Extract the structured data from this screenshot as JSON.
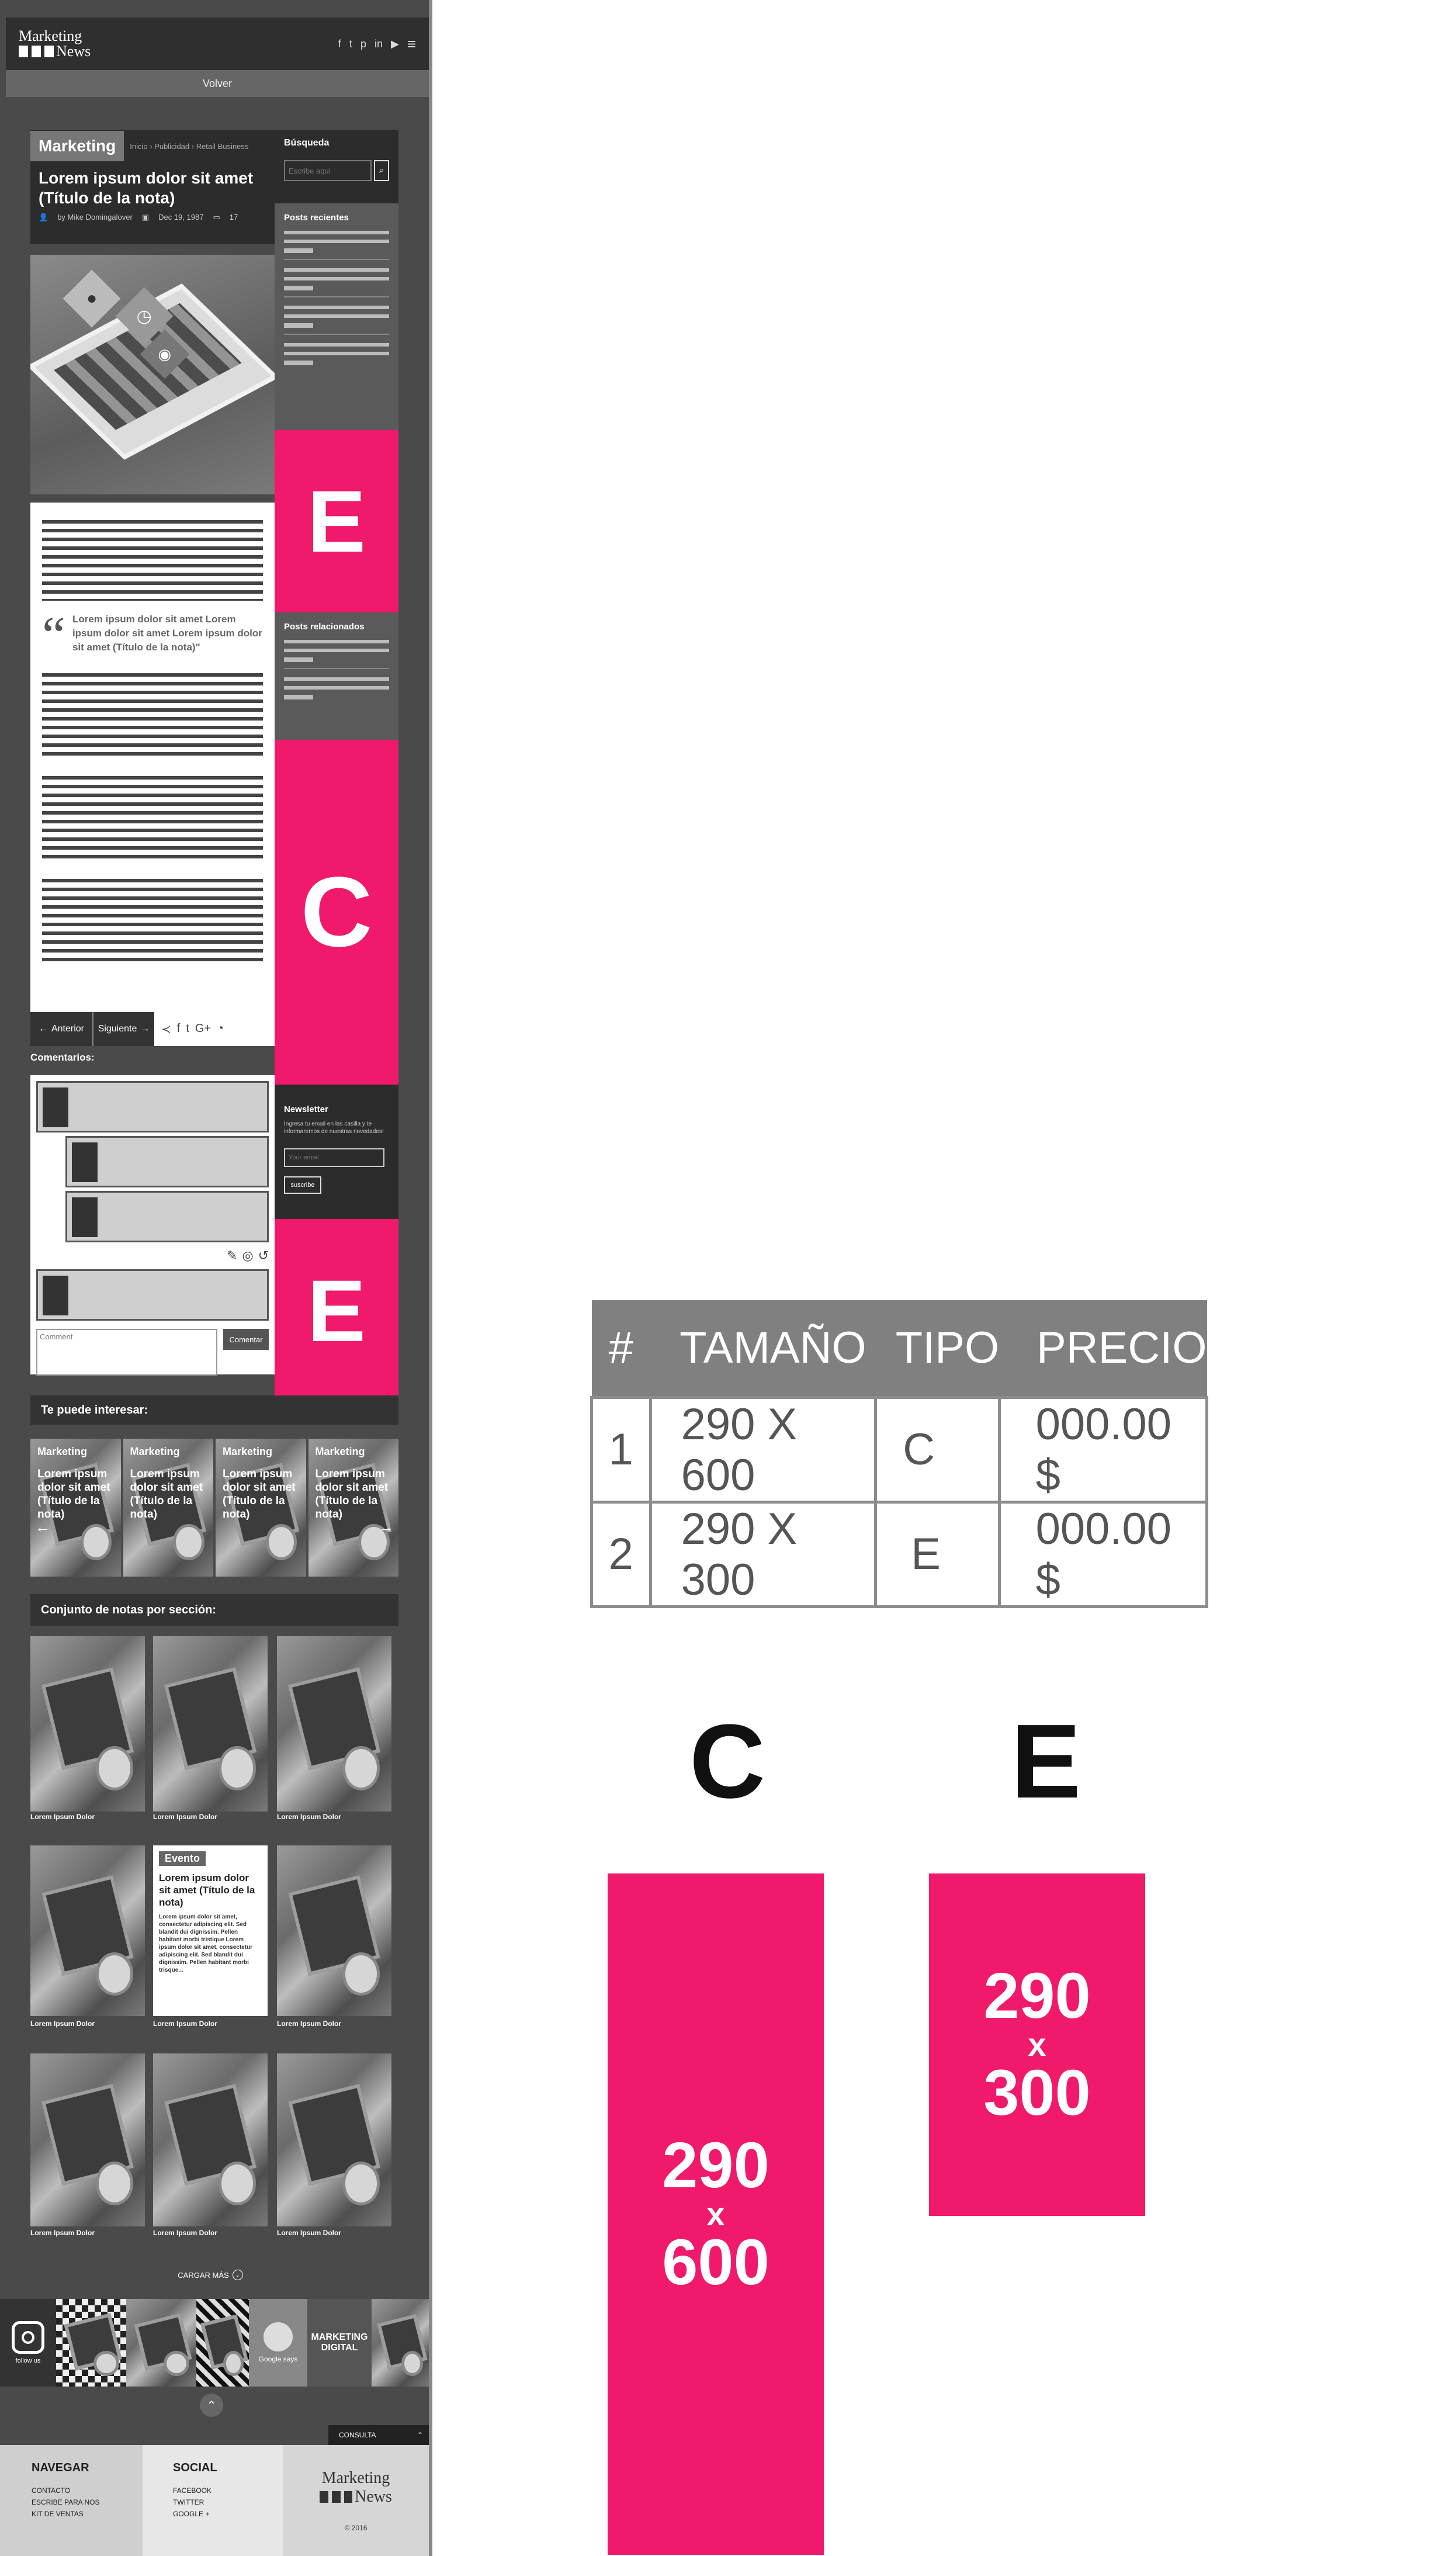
{
  "header": {
    "logo_top": "Marketing",
    "logo_bottom": "News",
    "social_icons": [
      "facebook-icon",
      "twitter-icon",
      "pinterest-icon",
      "linkedin-icon",
      "youtube-icon"
    ],
    "back_label": "Volver"
  },
  "article": {
    "category": "Marketing",
    "breadcrumb": "Inicio › Publicidad › Retail Business",
    "title": "Lorem ipsum dolor sit amet (Título de la nota)",
    "meta_author": "by Mike Domingalover",
    "meta_date": "Dec 19, 1987",
    "meta_comments": "17",
    "quote": "Lorem ipsum dolor sit amet Lorem ipsum dolor sit amet Lorem ipsum dolor sit amet (Título de la nota)\"",
    "prev_label": "Anterior",
    "next_label": "Siguiente"
  },
  "sidebar": {
    "search_title": "Búsqueda",
    "search_placeholder": "Escribe aquí",
    "recent_title": "Posts recientes",
    "related_title": "Posts relacionados",
    "newsletter_title": "Newsletter",
    "newsletter_text": "Ingresa tu email en las casilla y te informaremos de nuestras novedades!",
    "newsletter_placeholder": "Your email",
    "subscribe_label": "suscribe",
    "ad_letter_e": "E",
    "ad_letter_c": "C"
  },
  "comments": {
    "title": "Comentarios:",
    "input_placeholder": "Comment",
    "submit_label": "Comentar"
  },
  "interest": {
    "title": "Te puede interesar:",
    "cards": [
      {
        "category": "Marketing",
        "title": "Lorem ipsum dolor sit amet (Título de la nota)"
      },
      {
        "category": "Marketing",
        "title": "Lorem ipsum dolor sit amet (Título de la nota)"
      },
      {
        "category": "Marketing",
        "title": "Lorem ipsum dolor sit amet (Título de la nota)"
      },
      {
        "category": "Marketing",
        "title": "Lorem ipsum dolor sit amet (Título de la nota)"
      }
    ]
  },
  "section_notes": {
    "title": "Conjunto de notas por sección:",
    "item_title": "Lorem Ipsum Dolor",
    "event_badge": "Evento",
    "event_title": "Lorem ipsum dolor sit amet (Título de la nota)",
    "event_text": "Lorem ipsum dolor sit amet, consectetur adipiscing elit. Sed blandit dui dignissim. Pellen habitant morbi tristique Lorem ipsum dolor sit amet, consectetur adipiscing elit. Sed blandit dui dignissim. Pellen habitant morbi trisque...",
    "load_more": "CARGAR MÁS"
  },
  "instagram": {
    "handle": "follow us",
    "google_label": "Google says",
    "ad_label": "MARKETING DIGITAL"
  },
  "consulta_label": "CONSULTA",
  "footer": {
    "nav_title": "NAVEGAR",
    "nav_items": [
      "CONTACTO",
      "ESCRIBE PARA NOS",
      "KIT DE VENTAS"
    ],
    "social_title": "SOCIAL",
    "social_items": [
      "FACEBOOK",
      "TWITTER",
      "GOOGLE +"
    ],
    "logo_top": "Marketing",
    "logo_bottom": "News",
    "copyright": "© 2016"
  },
  "pricing": {
    "headers": [
      "#",
      "TAMAÑO",
      "TIPO",
      "PRECIO"
    ],
    "rows": [
      {
        "num": "1",
        "size": "290 X 600",
        "type": "C",
        "price": "000.00 $"
      },
      {
        "num": "2",
        "size": "290 X 300",
        "type": "E",
        "price": "000.00 $"
      }
    ]
  },
  "ad_samples": {
    "c_label": "C",
    "c_w": "290",
    "c_x": "x",
    "c_h": "600",
    "e_label": "E",
    "e_w": "290",
    "e_x": "x",
    "e_h": "300"
  },
  "colors": {
    "ad_pink": "#f0196b",
    "dark": "#444444",
    "header_gray": "#808080"
  }
}
